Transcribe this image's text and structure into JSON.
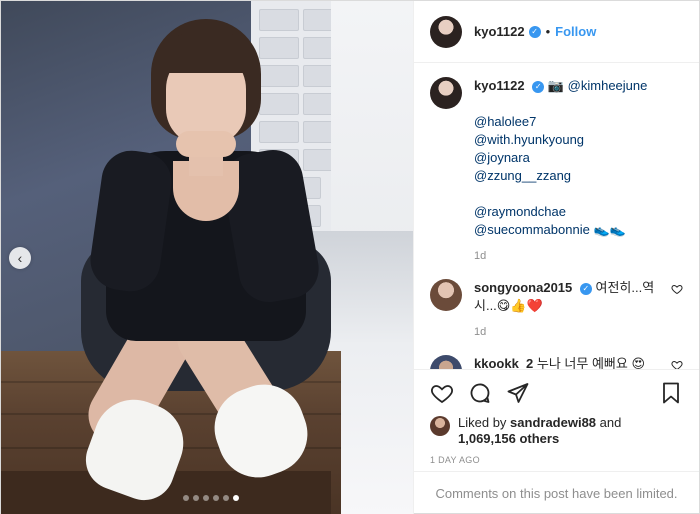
{
  "post": {
    "author": "kyo1122",
    "follow_label": "Follow",
    "separator": "•",
    "verified_mark": "✓"
  },
  "media": {
    "prev_icon": "‹",
    "carousel_total": 6,
    "carousel_active_index": 5
  },
  "caption": {
    "user": "kyo1122",
    "camera_emoji": "📷",
    "first_mention": "@kimheejune",
    "mentions_group_1": [
      "@halolee7",
      "@with.hyunkyoung",
      "@joynara",
      "@zzung__zzang"
    ],
    "mentions_group_2": [
      "@raymondchae"
    ],
    "last_mention": "@suecommabonnie",
    "last_emoji": "👟👟",
    "time": "1d"
  },
  "comments": [
    {
      "user": "songyoona2015",
      "verified": true,
      "text_line1": "여전히...역",
      "text_line2": "시...😋👍❤️",
      "time": "1d"
    },
    {
      "user": "kkookk_2",
      "verified": false,
      "text_line1": "누나 너무 예뻐요 😍",
      "text_line2": "😍😍",
      "time": ""
    }
  ],
  "likes": {
    "prefix": "Liked by",
    "user": "sandradewi88",
    "conjunction": "and",
    "count": "1,069,156 others"
  },
  "date": "1 DAY AGO",
  "comments_limited": "Comments on this post have been limited.",
  "colors": {
    "accent": "#3897f0",
    "text": "#262626",
    "muted": "#8e8e8e",
    "mention": "#003569"
  }
}
